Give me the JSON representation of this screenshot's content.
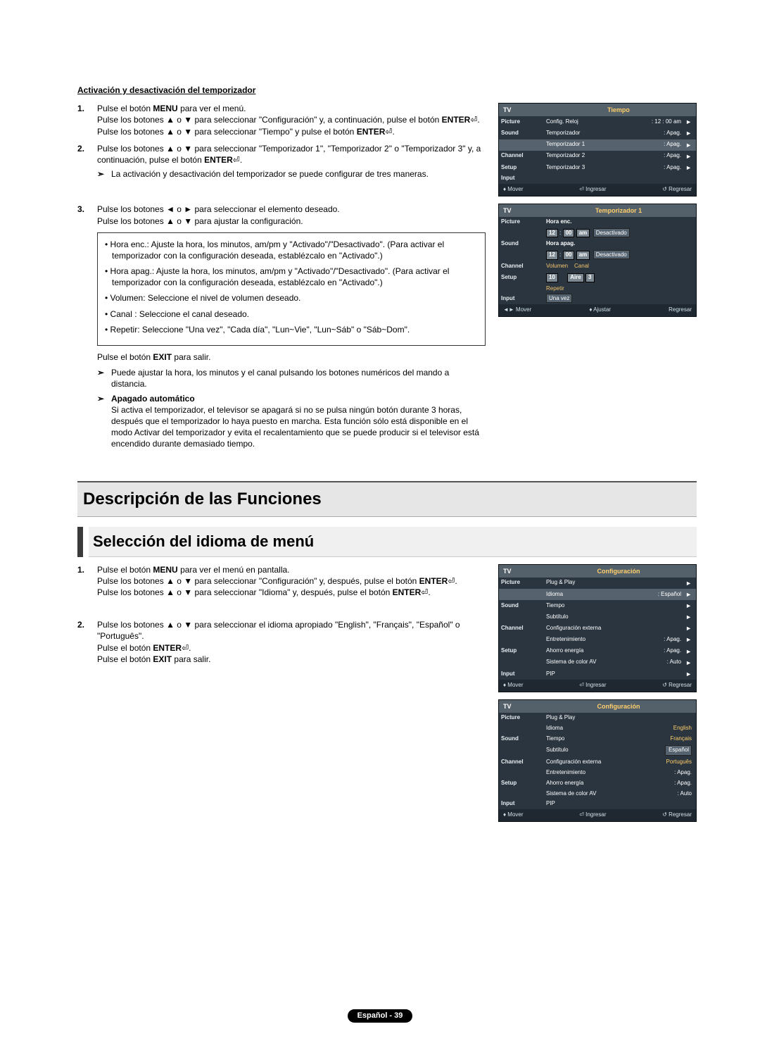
{
  "section1": {
    "title": "Activación y desactivación del temporizador",
    "step1": {
      "num": "1.",
      "p1a": "Pulse el botón ",
      "p1b": "MENU",
      "p1c": " para ver el menú.",
      "p2": "Pulse los botones ▲ o ▼ para seleccionar \"Configuración\" y, a continuación, pulse el botón ",
      "p2b": "ENTER",
      "p2e": ".",
      "p3": "Pulse los botones ▲ o ▼ para seleccionar \"Tiempo\" y pulse el botón ",
      "p3b": "ENTER",
      "p3e": "."
    },
    "step2": {
      "num": "2.",
      "p1": "Pulse los botones ▲ o ▼ para seleccionar \"Temporizador 1\", \"Temporizador 2\" o \"Temporizador 3\"  y, a continuación, pulse el botón ",
      "p1b": "ENTER",
      "p1e": ".",
      "note": "La activación y desactivación del temporizador se puede configurar de tres maneras."
    },
    "step3": {
      "num": "3.",
      "p1": "Pulse los botones ◄ o ► para seleccionar el elemento deseado.",
      "p2": "Pulse los botones ▲ o ▼ para ajustar la configuración.",
      "box": {
        "i1": "• Hora enc.: Ajuste la hora, los minutos, am/pm y \"Activado\"/\"Desactivado\". (Para activar el temporizador con la configuración deseada, establézcalo en \"Activado\".)",
        "i2": "• Hora apag.: Ajuste la hora, los minutos, am/pm y \"Activado\"/\"Desactivado\". (Para activar el temporizador con la configuración deseada, establézcalo en \"Activado\".)",
        "i3": "• Volumen: Seleccione el nivel de volumen deseado.",
        "i4": "• Canal : Seleccione el canal deseado.",
        "i5": "• Repetir: Seleccione \"Una vez\", \"Cada día\", \"Lun~Vie\", \"Lun~Sáb\" o \"Sáb~Dom\"."
      },
      "exit": "Pulse el botón EXIT para salir.",
      "note1": "Puede ajustar la hora, los minutos y el canal pulsando los botones numéricos del mando a distancia.",
      "note2title": "Apagado automático",
      "note2body": "Si activa el temporizador, el televisor se apagará si no se pulsa ningún botón durante 3 horas, después que el temporizador lo haya puesto en marcha. Esta función sólo está disponible en el modo Activar del temporizador y evita el recalentamiento que se puede producir si el televisor está encendido durante demasiado tiempo."
    }
  },
  "h1": "Descripción de las Funciones",
  "h2": "Selección del idioma de menú",
  "section2": {
    "step1": {
      "num": "1.",
      "p1a": "Pulse el botón ",
      "p1b": "MENU",
      "p1c": " para ver el menú en pantalla.",
      "p2": "Pulse los botones ▲ o ▼ para seleccionar \"Configuración\" y, después, pulse el botón ",
      "p2b": "ENTER",
      "p2e": ".",
      "p3": "Pulse los botones ▲ o ▼ para seleccionar \"Idioma\" y, después, pulse el botón ",
      "p3b": "ENTER",
      "p3e": "."
    },
    "step2": {
      "num": "2.",
      "p1": "Pulse los botones ▲ o ▼ para seleccionar el idioma apropiado \"English\", \"Français\", \"Español\" o \"Português\".",
      "p2a": "Pulse el botón ",
      "p2b": "ENTER",
      "p2e": ".",
      "p3a": "Pulse el botón ",
      "p3b": "EXIT",
      "p3c": " para salir."
    }
  },
  "osd1": {
    "tv": "TV",
    "header": "Tiempo",
    "rows": {
      "r1l": "Picture",
      "r1m": "Config. Reloj",
      "r1v": ": 12 : 00 am",
      "r2l": "Sound",
      "r2m": "Temporizador",
      "r2v": ": Apag.",
      "r3l": "",
      "r3m": "Temporizador 1",
      "r3v": ": Apag.",
      "r4l": "Channel",
      "r4m": "Temporizador 2",
      "r4v": ": Apag.",
      "r5l": "Setup",
      "r5m": "Temporizador 3",
      "r5v": ": Apag.",
      "r6l": "Input"
    },
    "footer": {
      "a": "♦ Mover",
      "b": "⏎ Ingresar",
      "c": "↺ Regresar"
    }
  },
  "osd2": {
    "tv": "TV",
    "header": "Temporizador 1",
    "labels": {
      "picture": "Picture",
      "sound": "Sound",
      "channel": "Channel",
      "setup": "Setup",
      "input": "Input",
      "horaenc": "Hora enc.",
      "horaapag": "Hora apag.",
      "vol": "Volumen",
      "canal": "Canal",
      "rep": "Repetir",
      "h12": "12",
      "m00": "00",
      "am": "am",
      "desact": "Desactivado",
      "ten": "10",
      "aire": "Aire",
      "three": "3",
      "unavez": "Una vez"
    },
    "footer": {
      "a": "◄► Mover",
      "b": "♦ Ajustar",
      "c": "Regresar"
    }
  },
  "osd3": {
    "tv": "TV",
    "header": "Configuración",
    "rows": {
      "r1l": "Picture",
      "r1m": "Plug & Play",
      "r2l": "",
      "r2m": "Idioma",
      "r2v": ": Español",
      "r3l": "Sound",
      "r3m": "Tiempo",
      "r4l": "",
      "r4m": "Subtítulo",
      "r5l": "Channel",
      "r5m": "Configuración externa",
      "r6l": "",
      "r6m": "Entretenimiento",
      "r6v": ": Apag.",
      "r7l": "Setup",
      "r7m": "Ahorro energía",
      "r7v": ": Apag.",
      "r8l": "",
      "r8m": "Sistema de color AV",
      "r8v": ": Auto",
      "r9l": "Input",
      "r9m": "PIP"
    },
    "footer": {
      "a": "♦ Mover",
      "b": "⏎ Ingresar",
      "c": "↺ Regresar"
    }
  },
  "osd4": {
    "tv": "TV",
    "header": "Configuración",
    "rows": {
      "r1l": "Picture",
      "r1m": "Plug & Play",
      "r2l": "",
      "r2m": "Idioma",
      "r2v": "English",
      "r3l": "Sound",
      "r3m": "Tiempo",
      "r3v": "Français",
      "r4l": "",
      "r4m": "Subtítulo",
      "r4v": "Español",
      "r5l": "Channel",
      "r5m": "Configuración externa",
      "r5v": "Português",
      "r6l": "",
      "r6m": "Entretenimiento",
      "r6v": ": Apag.",
      "r7l": "Setup",
      "r7m": "Ahorro energía",
      "r7v": ": Apag.",
      "r8l": "",
      "r8m": "Sistema de color AV",
      "r8v": ": Auto",
      "r9l": "Input",
      "r9m": "PIP"
    },
    "footer": {
      "a": "♦ Mover",
      "b": "⏎ Ingresar",
      "c": "↺ Regresar"
    }
  },
  "pagefoot": "Español - 39",
  "sym": "➣"
}
